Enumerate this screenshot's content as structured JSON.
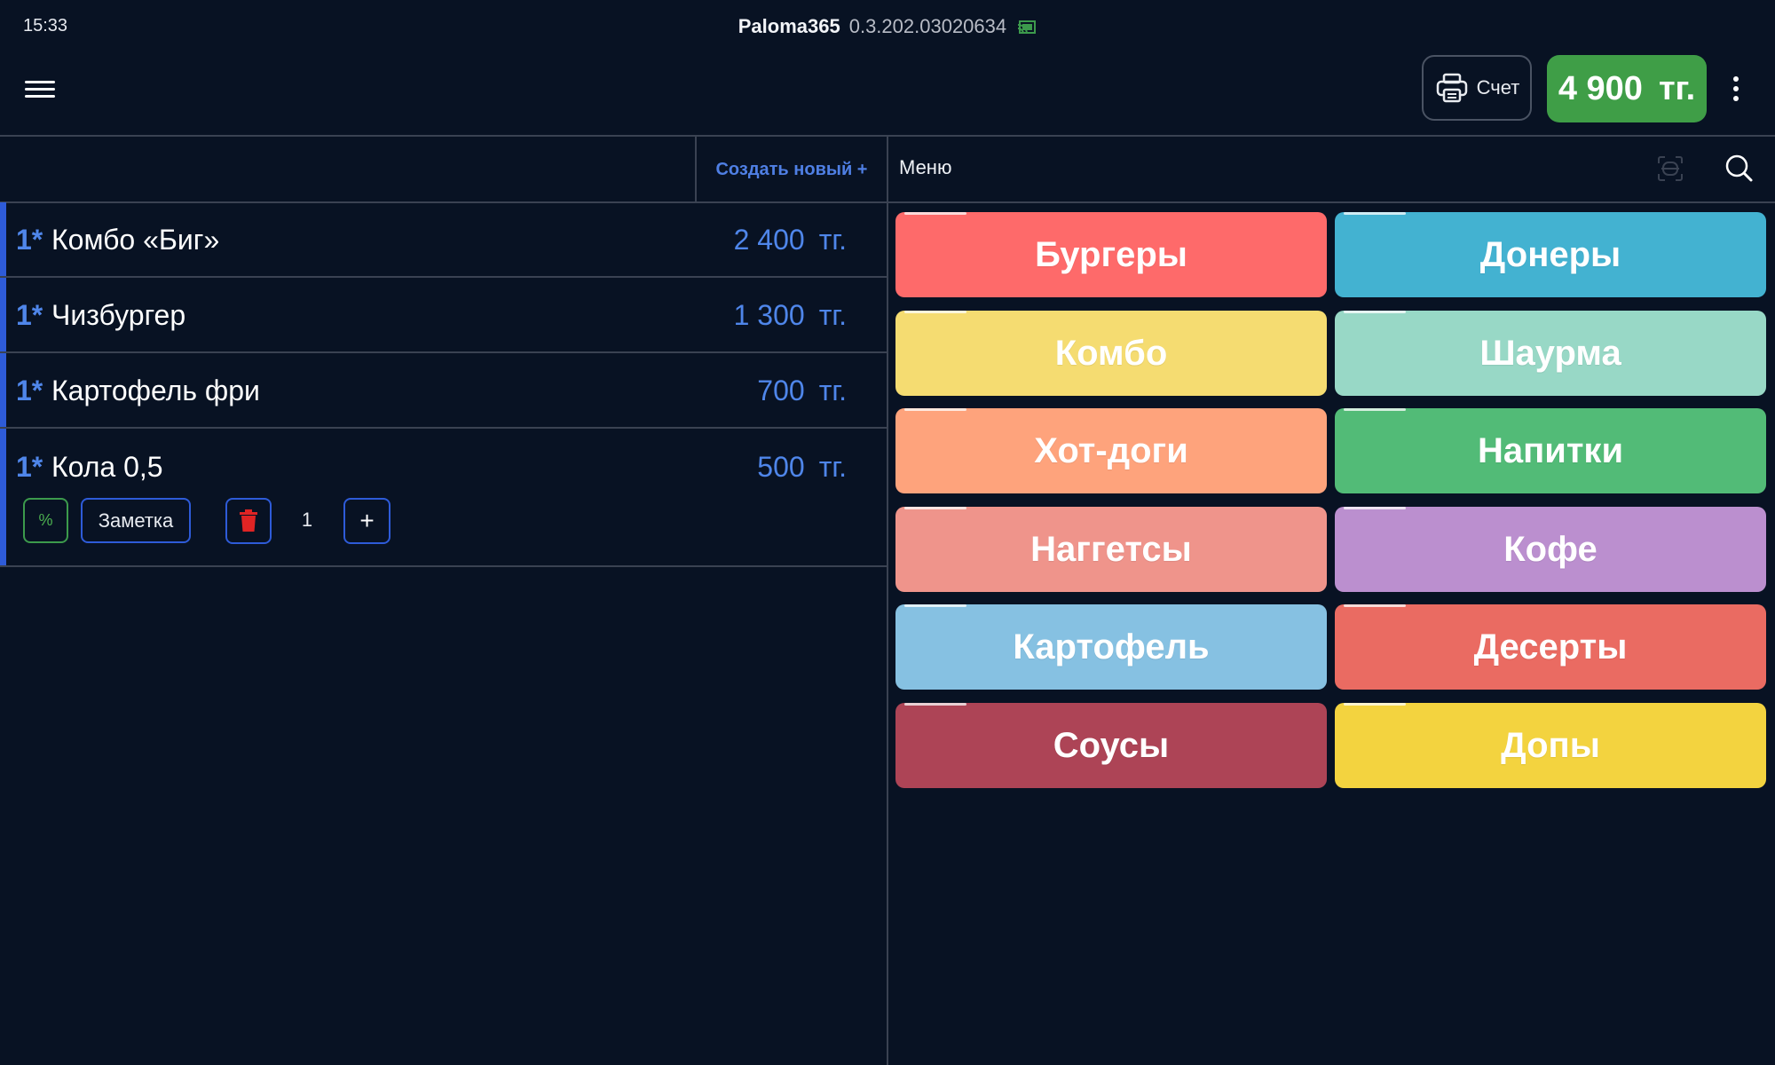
{
  "status_bar": {
    "time": "15:33",
    "app_name": "Paloma365",
    "app_version": "0.3.202.03020634",
    "cast_icon": "cast-icon"
  },
  "toolbar": {
    "menu_icon": "hamburger-menu-icon",
    "bill_label": "Счет",
    "bill_icon": "printer-icon",
    "total_amount": "4 900",
    "total_currency": "тг.",
    "total_color": "#3f9e47",
    "more_icon": "more-vertical-icon"
  },
  "order_panel": {
    "create_new_label": "Создать новый +",
    "accent_color": "#2e5bd8",
    "items": [
      {
        "qty": "1*",
        "name": "Комбо «Биг»",
        "price": "2 400",
        "currency": "тг."
      },
      {
        "qty": "1*",
        "name": "Чизбургер",
        "price": "1 300",
        "currency": "тг."
      },
      {
        "qty": "1*",
        "name": "Картофель фри",
        "price": "700",
        "currency": "тг."
      },
      {
        "qty": "1*",
        "name": "Кола 0,5",
        "price": "500",
        "currency": "тг."
      }
    ],
    "selected_item_controls": {
      "discount_label": "%",
      "note_label": "Заметка",
      "delete_icon": "trash-icon",
      "quantity": "1",
      "plus_label": "+"
    }
  },
  "menu_panel": {
    "title": "Меню",
    "scan_icon": "scan-icon",
    "search_icon": "search-icon",
    "categories": [
      {
        "label": "Бургеры",
        "color": "#fe6a6a"
      },
      {
        "label": "Донеры",
        "color": "#43b2d1"
      },
      {
        "label": "Комбо",
        "color": "#f5dc71"
      },
      {
        "label": "Шаурма",
        "color": "#98d8c6"
      },
      {
        "label": "Хот-доги",
        "color": "#fea37c"
      },
      {
        "label": "Напитки",
        "color": "#52bb77"
      },
      {
        "label": "Наггетсы",
        "color": "#ef948b"
      },
      {
        "label": "Кофе",
        "color": "#bb8fcf"
      },
      {
        "label": "Картофель",
        "color": "#86c1e2"
      },
      {
        "label": "Десерты",
        "color": "#ea6b62"
      },
      {
        "label": "Соусы",
        "color": "#ad4456"
      },
      {
        "label": "Допы",
        "color": "#f3d33f"
      }
    ]
  }
}
